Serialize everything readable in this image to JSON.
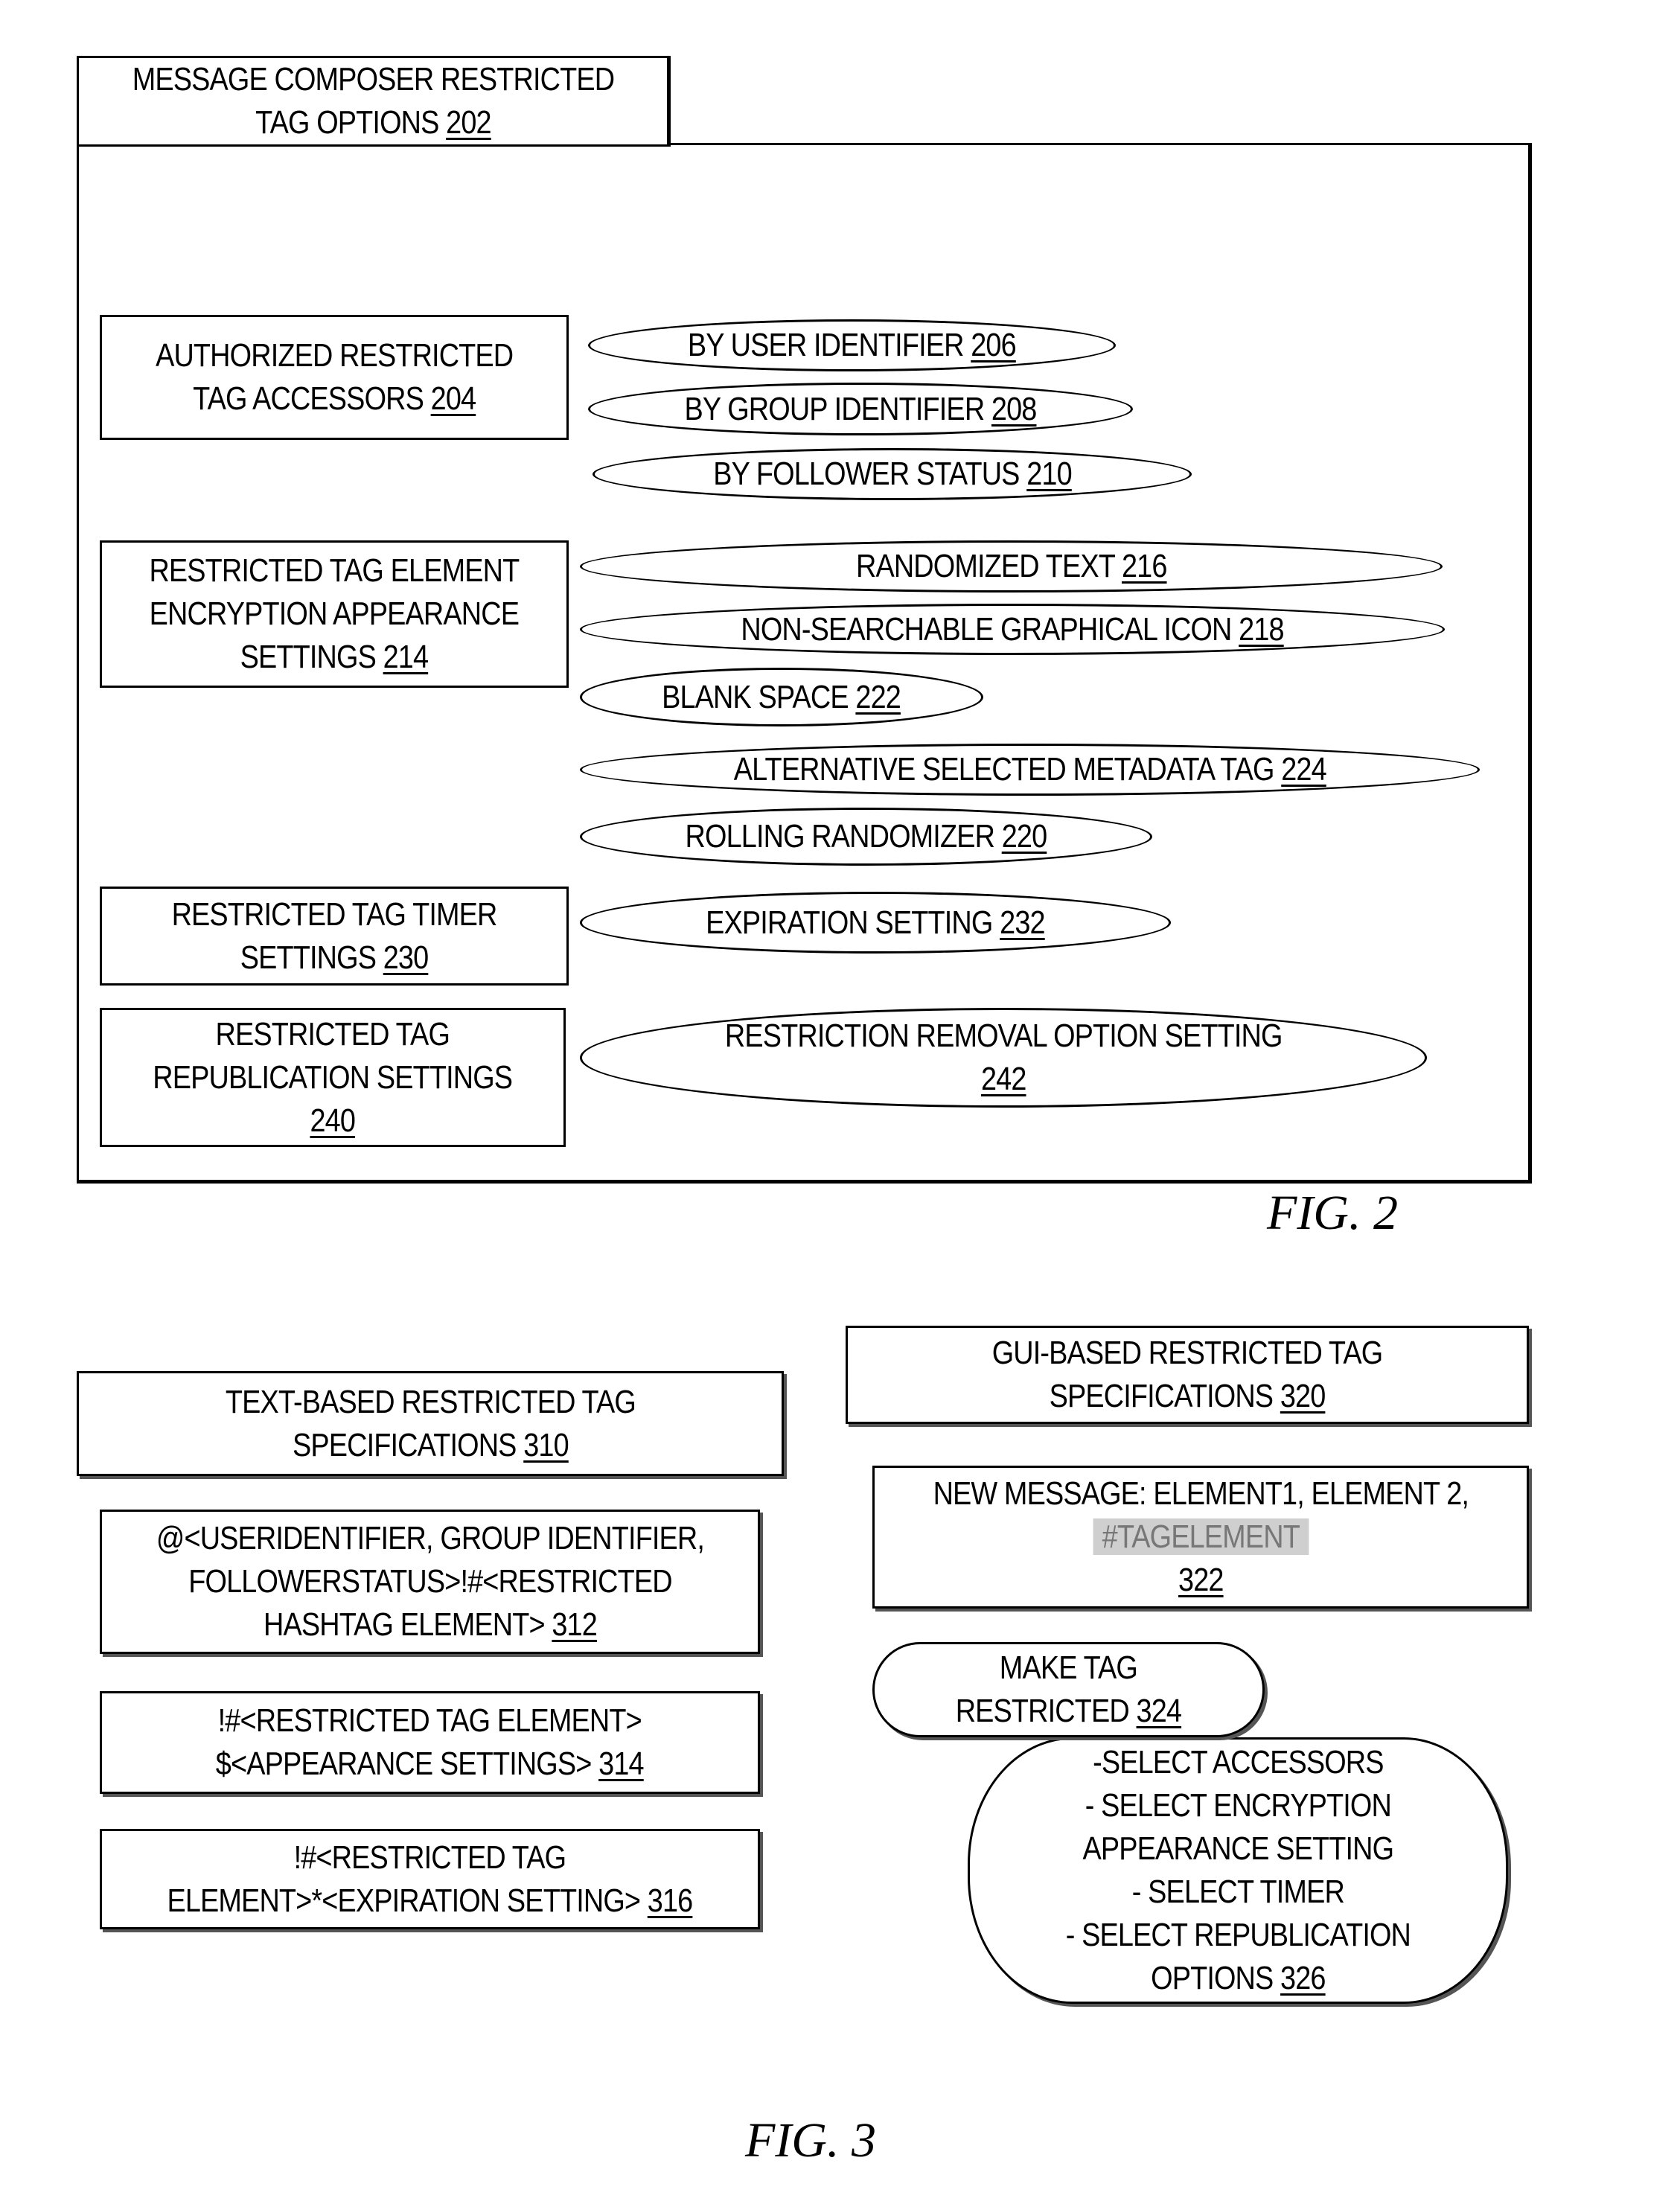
{
  "fig2": {
    "title": {
      "text": "MESSAGE COMPOSER RESTRICTED",
      "text2": "TAG OPTIONS ",
      "ref": "202"
    },
    "groups": [
      {
        "lines": [
          "AUTHORIZED RESTRICTED",
          "TAG ACCESSORS "
        ],
        "ref": "204"
      },
      {
        "lines": [
          "RESTRICTED TAG ELEMENT",
          "ENCRYPTION APPEARANCE",
          "SETTINGS "
        ],
        "ref": "214"
      },
      {
        "lines": [
          "RESTRICTED TAG TIMER",
          "SETTINGS "
        ],
        "ref": "230"
      },
      {
        "lines": [
          "RESTRICTED TAG",
          "REPUBLICATION SETTINGS",
          ""
        ],
        "ref": "240"
      }
    ],
    "options": [
      {
        "text": "BY USER IDENTIFIER ",
        "ref": "206"
      },
      {
        "text": "BY GROUP IDENTIFIER ",
        "ref": "208"
      },
      {
        "text": "BY FOLLOWER STATUS ",
        "ref": "210"
      },
      {
        "text": "RANDOMIZED  TEXT ",
        "ref": "216"
      },
      {
        "text": "NON-SEARCHABLE GRAPHICAL ICON ",
        "ref": "218"
      },
      {
        "text": "BLANK SPACE ",
        "ref": "222"
      },
      {
        "text": "ALTERNATIVE SELECTED METADATA TAG ",
        "ref": "224"
      },
      {
        "text": "ROLLING RANDOMIZER ",
        "ref": "220"
      },
      {
        "text": "EXPIRATION SETTING ",
        "ref": "232"
      },
      {
        "text": "RESTRICTION REMOVAL OPTION SETTING",
        "ref": "242"
      }
    ],
    "caption": "FIG. 2"
  },
  "fig3": {
    "text_based": {
      "lines": [
        "TEXT-BASED RESTRICTED TAG",
        "SPECIFICATIONS "
      ],
      "ref": "310"
    },
    "syntax": [
      {
        "lines": [
          "@<USERIDENTIFIER, GROUP IDENTIFIER,",
          "FOLLOWERSTATUS>!#<RESTRICTED",
          "HASHTAG ELEMENT>  "
        ],
        "ref": "312"
      },
      {
        "lines": [
          "!#<RESTRICTED TAG ELEMENT>",
          "$<APPEARANCE SETTINGS>  "
        ],
        "ref": "314"
      },
      {
        "lines": [
          "!#<RESTRICTED TAG",
          "ELEMENT>*<EXPIRATION SETTING>  "
        ],
        "ref": "316"
      }
    ],
    "gui_based": {
      "lines": [
        "GUI-BASED RESTRICTED TAG",
        "SPECIFICATIONS "
      ],
      "ref": "320"
    },
    "new_message": {
      "line1": "NEW MESSAGE:   ELEMENT1, ELEMENT 2,",
      "tag": "#TAGELEMENT",
      "ref": "322"
    },
    "make_tag": {
      "lines": [
        "MAKE TAG",
        "RESTRICTED  "
      ],
      "ref": "324"
    },
    "menu": {
      "lines": [
        "-SELECT ACCESSORS",
        "- SELECT ENCRYPTION",
        "APPEARANCE SETTING",
        "- SELECT TIMER",
        "- SELECT REPUBLICATION",
        "OPTIONS  "
      ],
      "ref": "326"
    },
    "caption": "FIG. 3"
  }
}
